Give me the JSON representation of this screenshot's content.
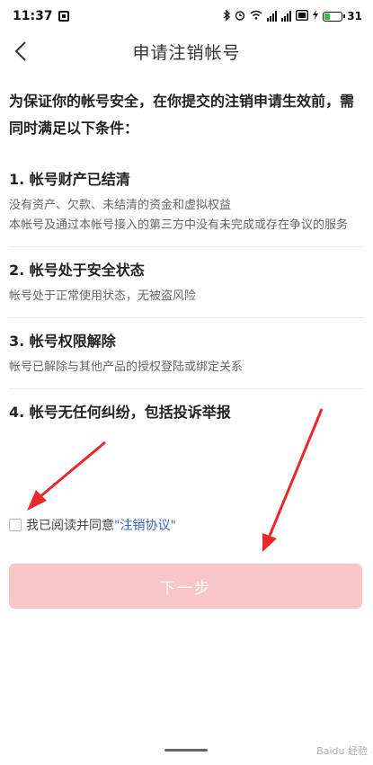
{
  "status_bar": {
    "time": "11:37",
    "battery": "31",
    "battery_level": 0.31,
    "icons": [
      "notification-icon",
      "bluetooth-icon",
      "alarm-icon",
      "wifi-icon",
      "signal-icon",
      "signal-icon",
      "hd-icon",
      "charging-icon",
      "battery-icon"
    ]
  },
  "header": {
    "back_icon": "chevron-left-icon",
    "title": "申请注销帐号"
  },
  "intro": "为保证你的帐号安全，在你提交的注销申请生效前，需同时满足以下条件：",
  "conditions": [
    {
      "title": "1. 帐号财产已结清",
      "desc": [
        "没有资产、欠款、未结清的资金和虚拟权益",
        "本帐号及通过本帐号接入的第三方中没有未完成或存在争议的服务"
      ]
    },
    {
      "title": "2. 帐号处于安全状态",
      "desc": [
        "帐号处于正常使用状态，无被盗风险"
      ]
    },
    {
      "title": "3. 帐号权限解除",
      "desc": [
        "帐号已解除与其他产品的授权登陆或绑定关系"
      ]
    },
    {
      "title": "4. 帐号无任何纠纷，包括投诉举报",
      "desc": []
    }
  ],
  "agreement": {
    "checked": false,
    "text": "我已阅读并同意",
    "link": "\"注销协议\""
  },
  "next_button": {
    "label": "下一步",
    "color": "#f9c6c8"
  },
  "annotation_color": "#e8282b",
  "watermark": "Baidu 经验"
}
